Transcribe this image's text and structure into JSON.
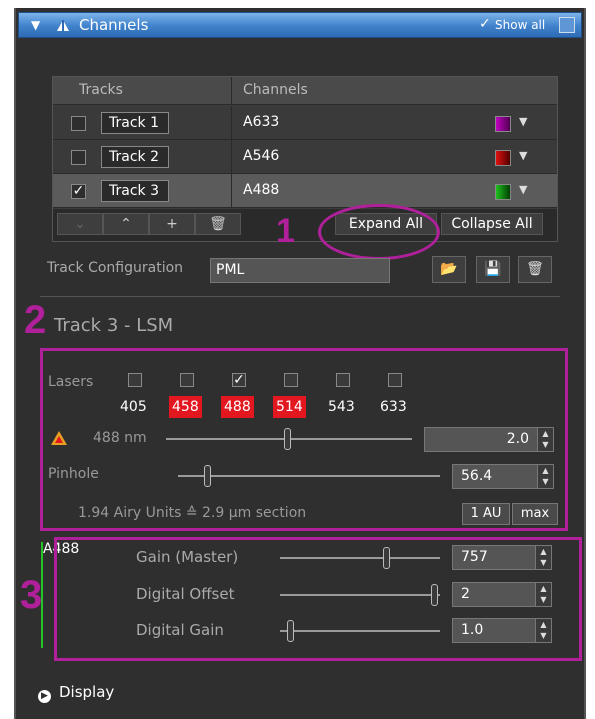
{
  "top_caption": "Expand All Collapse All",
  "header": {
    "title": "Channels",
    "show_all_label": "Show all",
    "show_all_checked": true
  },
  "tracks_table": {
    "col_tracks": "Tracks",
    "col_channels": "Channels",
    "rows": [
      {
        "name": "Track 1",
        "channel": "A633",
        "checked": false,
        "color": "#c000c0"
      },
      {
        "name": "Track 2",
        "channel": "A546",
        "checked": false,
        "color": "#e01010"
      },
      {
        "name": "Track 3",
        "channel": "A488",
        "checked": true,
        "color": "#20c020",
        "selected": true
      }
    ],
    "toolbar": {
      "expand_all": "Expand All",
      "collapse_all": "Collapse All"
    }
  },
  "annotations": [
    "1",
    "2",
    "3"
  ],
  "track_configuration": {
    "label": "Track Configuration",
    "value": "PML"
  },
  "section_title": "Track 3 - LSM",
  "lasers": {
    "label": "Lasers",
    "items": [
      {
        "wavelength": "405",
        "checked": false,
        "active": false
      },
      {
        "wavelength": "458",
        "checked": false,
        "active": true
      },
      {
        "wavelength": "488",
        "checked": true,
        "active": true
      },
      {
        "wavelength": "514",
        "checked": false,
        "active": true
      },
      {
        "wavelength": "543",
        "checked": false,
        "active": false
      },
      {
        "wavelength": "633",
        "checked": false,
        "active": false
      }
    ]
  },
  "laser_power": {
    "label": "488 nm",
    "value": "2.0",
    "level": 0.49
  },
  "pinhole": {
    "label": "Pinhole",
    "value": "56.4",
    "level": 0.11,
    "airy_text": "1.94 Airy Units  ≙  2.9 µm section",
    "btn_1au": "1 AU",
    "btn_max": "max"
  },
  "channel_detail": {
    "channel_label": "A488",
    "gain_master": {
      "label": "Gain (Master)",
      "value": "757",
      "level": 0.66
    },
    "digital_offset": {
      "label": "Digital Offset",
      "value": "2",
      "level": 0.96
    },
    "digital_gain": {
      "label": "Digital Gain",
      "value": "1.0",
      "level": 0.06
    }
  },
  "display_label": "Display",
  "colors": {
    "annotation": "#b0209a",
    "laser_active": "#e2171f",
    "header_blue": "#3f82cc",
    "channel_line": "#27c427"
  }
}
